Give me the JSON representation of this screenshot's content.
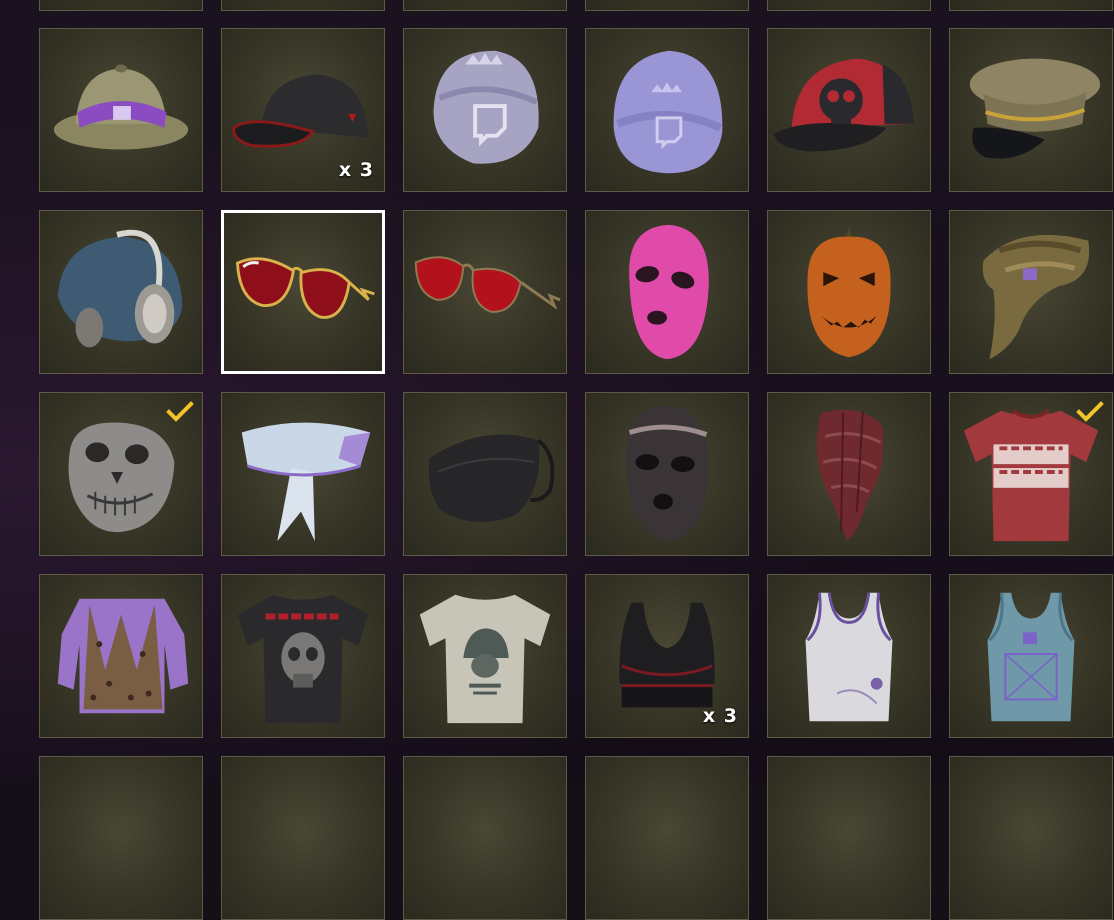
{
  "inventory": {
    "accent_color": "#f2c32a",
    "selected_border_color": "#ffffff",
    "items": [
      {
        "name": "pith-helmet-purple-band",
        "quantity": "",
        "equipped": false
      },
      {
        "name": "black-baseball-cap",
        "quantity": "x 3",
        "equipped": false
      },
      {
        "name": "twitch-headwrap-lavender",
        "quantity": "",
        "equipped": false
      },
      {
        "name": "twitch-beanie-lavender",
        "quantity": "",
        "equipped": false
      },
      {
        "name": "red-skull-snapback",
        "quantity": "",
        "equipped": false
      },
      {
        "name": "officer-peaked-cap",
        "quantity": "",
        "equipped": false
      },
      {
        "name": "beanie-with-headphones",
        "quantity": "",
        "equipped": false
      },
      {
        "name": "gold-red-sunglasses",
        "quantity": "",
        "equipped": false,
        "selected": true
      },
      {
        "name": "red-aviator-sunglasses",
        "quantity": "",
        "equipped": false
      },
      {
        "name": "pink-balaclava",
        "quantity": "",
        "equipped": false
      },
      {
        "name": "pumpkin-mask",
        "quantity": "",
        "equipped": false
      },
      {
        "name": "camo-bandana-headwrap",
        "quantity": "",
        "equipped": false
      },
      {
        "name": "silver-skull-half-mask",
        "quantity": "",
        "equipped": true
      },
      {
        "name": "white-neck-scarf",
        "quantity": "",
        "equipped": false
      },
      {
        "name": "black-face-mask",
        "quantity": "",
        "equipped": false
      },
      {
        "name": "dark-ski-mask",
        "quantity": "",
        "equipped": false
      },
      {
        "name": "red-plaid-face-scarf",
        "quantity": "",
        "equipped": false
      },
      {
        "name": "red-chicken-dinner-tshirt",
        "quantity": "",
        "equipped": true
      },
      {
        "name": "leopard-vest-purple-shirt",
        "quantity": "",
        "equipped": false
      },
      {
        "name": "sanhok-skull-tshirt",
        "quantity": "",
        "equipped": false
      },
      {
        "name": "battlegrounds-helmet-tshirt",
        "quantity": "",
        "equipped": false
      },
      {
        "name": "black-sports-bra",
        "quantity": "x 3",
        "equipped": false
      },
      {
        "name": "white-tank-top",
        "quantity": "",
        "equipped": false
      },
      {
        "name": "teal-twitch-tank-top",
        "quantity": "",
        "equipped": false
      }
    ]
  }
}
